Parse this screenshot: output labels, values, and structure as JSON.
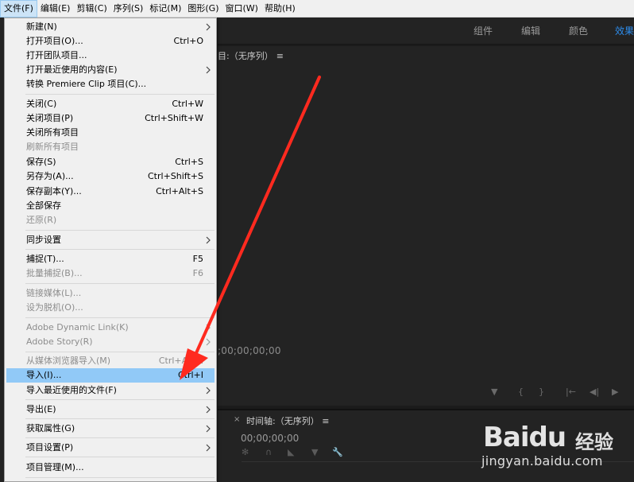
{
  "menubar": {
    "items": [
      "文件(F)",
      "编辑(E)",
      "剪辑(C)",
      "序列(S)",
      "标记(M)",
      "图形(G)",
      "窗口(W)",
      "帮助(H)"
    ]
  },
  "workspaces": {
    "tabs": [
      "组件",
      "编辑",
      "颜色",
      "效果"
    ],
    "active": "效果"
  },
  "monitor": {
    "title": "目:（无序列）",
    "menu_glyph": "≡",
    "timecode": ";00;00;00;00"
  },
  "timeline": {
    "close_glyph": "×",
    "title": "时间轴:（无序列）",
    "menu_glyph": "≡",
    "timecode": "00;00;00;00"
  },
  "file_menu": {
    "items": [
      {
        "label": "新建(N)",
        "shortcut": "",
        "submenu": true,
        "disabled": false
      },
      {
        "label": "打开项目(O)...",
        "shortcut": "Ctrl+O",
        "submenu": false,
        "disabled": false
      },
      {
        "label": "打开团队项目...",
        "shortcut": "",
        "submenu": false,
        "disabled": false
      },
      {
        "label": "打开最近使用的内容(E)",
        "shortcut": "",
        "submenu": true,
        "disabled": false
      },
      {
        "label": "转换 Premiere Clip 项目(C)...",
        "shortcut": "",
        "submenu": false,
        "disabled": false
      },
      {
        "label": "关闭(C)",
        "shortcut": "Ctrl+W",
        "submenu": false,
        "disabled": false
      },
      {
        "label": "关闭项目(P)",
        "shortcut": "Ctrl+Shift+W",
        "submenu": false,
        "disabled": false
      },
      {
        "label": "关闭所有项目",
        "shortcut": "",
        "submenu": false,
        "disabled": false
      },
      {
        "label": "刷新所有项目",
        "shortcut": "",
        "submenu": false,
        "disabled": true
      },
      {
        "label": "保存(S)",
        "shortcut": "Ctrl+S",
        "submenu": false,
        "disabled": false
      },
      {
        "label": "另存为(A)...",
        "shortcut": "Ctrl+Shift+S",
        "submenu": false,
        "disabled": false
      },
      {
        "label": "保存副本(Y)...",
        "shortcut": "Ctrl+Alt+S",
        "submenu": false,
        "disabled": false
      },
      {
        "label": "全部保存",
        "shortcut": "",
        "submenu": false,
        "disabled": false
      },
      {
        "label": "还原(R)",
        "shortcut": "",
        "submenu": false,
        "disabled": true
      },
      {
        "label": "同步设置",
        "shortcut": "",
        "submenu": true,
        "disabled": false
      },
      {
        "label": "捕捉(T)...",
        "shortcut": "F5",
        "submenu": false,
        "disabled": false
      },
      {
        "label": "批量捕捉(B)...",
        "shortcut": "F6",
        "submenu": false,
        "disabled": true
      },
      {
        "label": "链接媒体(L)...",
        "shortcut": "",
        "submenu": false,
        "disabled": true
      },
      {
        "label": "设为脱机(O)...",
        "shortcut": "",
        "submenu": false,
        "disabled": true
      },
      {
        "label": "Adobe Dynamic Link(K)",
        "shortcut": "",
        "submenu": true,
        "disabled": true
      },
      {
        "label": "Adobe Story(R)",
        "shortcut": "",
        "submenu": true,
        "disabled": true
      },
      {
        "label": "从媒体浏览器导入(M)",
        "shortcut": "Ctrl+Alt+I",
        "submenu": false,
        "disabled": true
      },
      {
        "label": "导入(I)...",
        "shortcut": "Ctrl+I",
        "submenu": false,
        "disabled": false,
        "highlighted": true
      },
      {
        "label": "导入最近使用的文件(F)",
        "shortcut": "",
        "submenu": true,
        "disabled": false
      },
      {
        "label": "导出(E)",
        "shortcut": "",
        "submenu": true,
        "disabled": false
      },
      {
        "label": "获取属性(G)",
        "shortcut": "",
        "submenu": true,
        "disabled": false
      },
      {
        "label": "项目设置(P)",
        "shortcut": "",
        "submenu": true,
        "disabled": false
      },
      {
        "label": "项目管理(M)...",
        "shortcut": "",
        "submenu": false,
        "disabled": false
      }
    ]
  },
  "watermark": {
    "brand": "Baidu",
    "cn": "经验",
    "url": "jingyan.baidu.com"
  },
  "colors": {
    "menu_bg": "#f0f0f0",
    "menu_highlight": "#91c9f7",
    "panel_bg": "#232323",
    "accent_blue": "#2d8ceb",
    "annotation_red": "#ff2a1f"
  }
}
